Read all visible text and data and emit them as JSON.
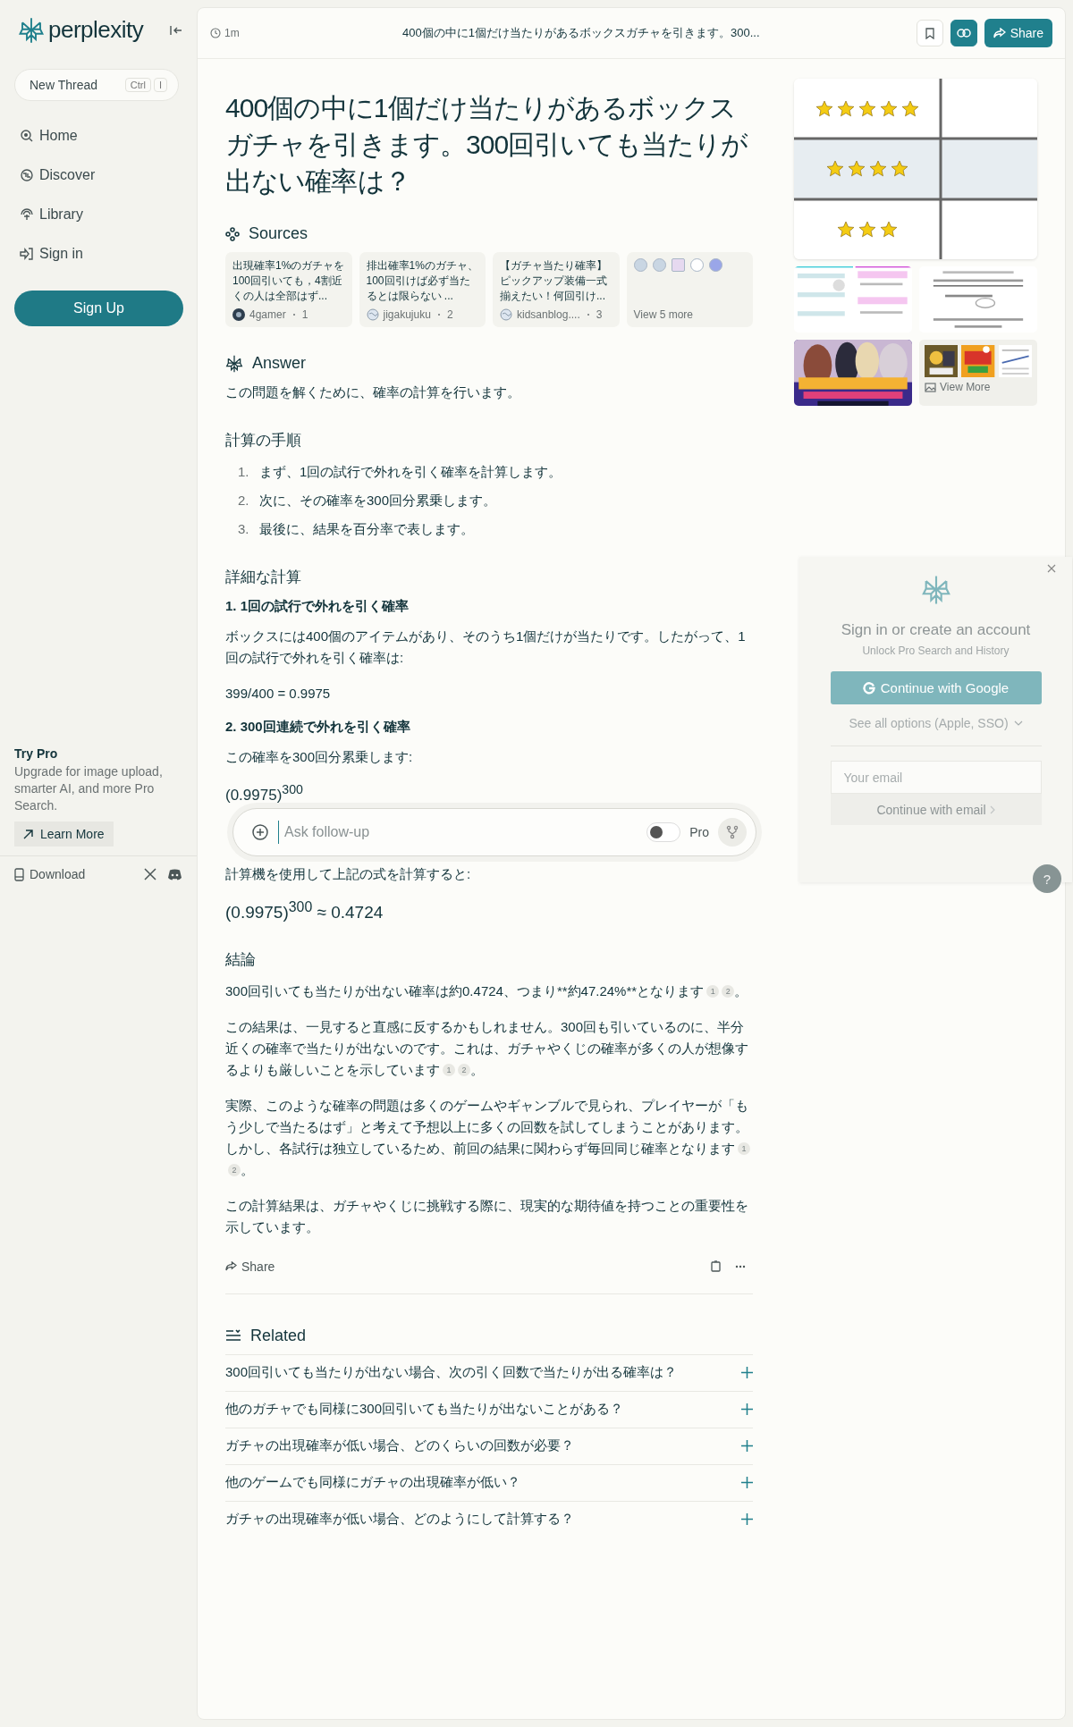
{
  "sidebar": {
    "brand": "perplexity",
    "new_thread": {
      "label": "New Thread",
      "keys": [
        "Ctrl",
        "I"
      ]
    },
    "nav": [
      {
        "label": "Home"
      },
      {
        "label": "Discover"
      },
      {
        "label": "Library"
      },
      {
        "label": "Sign in"
      }
    ],
    "signup": "Sign Up",
    "promo": {
      "title": "Try Pro",
      "text": "Upgrade for image upload, smarter AI, and more Pro Search.",
      "button": "Learn More"
    },
    "footer": {
      "download": "Download"
    }
  },
  "header": {
    "time": "1m",
    "title": "400個の中に1個だけ当たりがあるボックスガチャを引きます。300...",
    "share": "Share"
  },
  "question": "400個の中に1個だけ当たりがあるボックスガチャを引きます。300回引いても当たりが出ない確率は？",
  "sources": {
    "heading": "Sources",
    "items": [
      {
        "title": "出現確率1%のガチャを100回引いても，4割近くの人は全部はず...",
        "site": "4gamer",
        "index": "1"
      },
      {
        "title": "排出確率1%のガチャ、100回引けば必ず当たるとは限らない ...",
        "site": "jigakujuku",
        "index": "2"
      },
      {
        "title": "【ガチャ当たり確率】ピックアップ装備一式揃えたい！何回引け...",
        "site": "kidsanblog....",
        "index": "3"
      }
    ],
    "more": "View 5 more"
  },
  "answer": {
    "heading": "Answer",
    "blocks": [
      {
        "kind": "p",
        "text": "この問題を解くために、確率の計算を行います。"
      },
      {
        "kind": "h",
        "text": "計算の手順"
      },
      {
        "kind": "ol",
        "items": [
          {
            "n": "1.",
            "text": "まず、1回の試行で外れを引く確率を計算します。"
          },
          {
            "n": "2.",
            "text": "次に、その確率を300回分累乗します。"
          },
          {
            "n": "3.",
            "text": "最後に、結果を百分率で表します。"
          }
        ]
      },
      {
        "kind": "h",
        "text": "詳細な計算"
      },
      {
        "kind": "bold",
        "text": "1. 1回の試行で外れを引く確率"
      },
      {
        "kind": "p",
        "text": "ボックスには400個のアイテムがあり、そのうち1個だけが当たりです。したがって、1回の試行で外れを引く確率は:"
      },
      {
        "kind": "p",
        "text": "399/400 = 0.9975"
      },
      {
        "kind": "bold",
        "text": "2. 300回連続で外れを引く確率"
      },
      {
        "kind": "p",
        "text": "この確率を300回分累乗します:"
      },
      {
        "kind": "formula",
        "text": "(0.9975)$^{300}$"
      },
      {
        "kind": "follow_up",
        "placeholder": "Ask follow-up",
        "pro_label": "Pro",
        "pro_on": false
      },
      {
        "kind": "p",
        "text": "計算機を使用して上記の式を計算すると:"
      },
      {
        "kind": "formula_large",
        "text": "(0.9975)$^{300}$ ≈ 0.4724"
      },
      {
        "kind": "h",
        "text": "結論"
      },
      {
        "kind": "p",
        "text": "300回引いても当たりが出ない確率は約0.4724、つまり**約47.24%**となります",
        "citations": [
          "1",
          "2"
        ],
        "after": "。"
      },
      {
        "kind": "p",
        "text": "この結果は、一見すると直感に反するかもしれません。300回も引いているのに、半分近くの確率で当たりが出ないのです。これは、ガチャやくじの確率が多くの人が想像するよりも厳しいことを示しています",
        "citations": [
          "1",
          "2"
        ],
        "after": "。"
      },
      {
        "kind": "p",
        "text": "実際、このような確率の問題は多くのゲームやギャンブルで見られ、プレイヤーが「もう少しで当たるはず」と考えて予想以上に多くの回数を試してしまうことがあります。しかし、各試行は独立しているため、前回の結果に関わらず毎回同じ確率となります",
        "citations": [
          "1",
          "2"
        ],
        "after": "。"
      },
      {
        "kind": "p",
        "text": "この計算結果は、ガチャやくじに挑戦する際に、現実的な期待値を持つことの重要性を示しています。"
      }
    ],
    "share": "Share"
  },
  "related": {
    "heading": "Related",
    "items": [
      "300回引いても当たりが出ない場合、次の引く回数で当たりが出る確率は？",
      "他のガチャでも同様に300回引いても当たりが出ないことがある？",
      "ガチャの出現確率が低い場合、どのくらいの回数が必要？",
      "他のゲームでも同様にガチャの出現確率が低い？",
      "ガチャの出現確率が低い場合、どのようにして計算する？"
    ]
  },
  "images": {
    "more": "View More"
  },
  "signin": {
    "title": "Sign in or create an account",
    "subtitle": "Unlock Pro Search and History",
    "google": "Continue with Google",
    "options": "See all options (Apple, SSO)",
    "email_placeholder": "Your email",
    "email_button": "Continue with email",
    "help": "?"
  }
}
